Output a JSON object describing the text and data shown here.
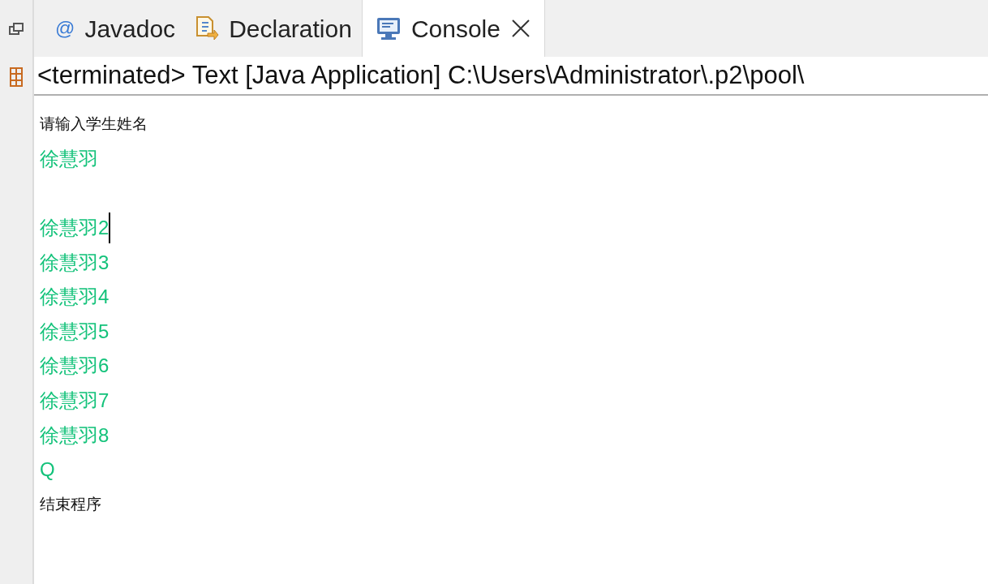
{
  "tabs": [
    {
      "label": "Javadoc",
      "kind": "javadoc",
      "glyph": "@",
      "selected": false
    },
    {
      "label": "Declaration",
      "kind": "declaration",
      "selected": false
    },
    {
      "label": "Console",
      "kind": "console",
      "selected": true
    }
  ],
  "console": {
    "title": "<terminated> Text [Java Application] C:\\Users\\Administrator\\.p2\\pool\\",
    "blocks": [
      [
        {
          "kind": "output",
          "text": "请输入学生姓名",
          "cursor": false
        },
        {
          "kind": "input",
          "text": "徐慧羽",
          "cursor": false
        }
      ],
      [
        {
          "kind": "input",
          "text": "徐慧羽2",
          "cursor": true
        },
        {
          "kind": "input",
          "text": "徐慧羽3",
          "cursor": false
        },
        {
          "kind": "input",
          "text": "徐慧羽4",
          "cursor": false
        },
        {
          "kind": "input",
          "text": "徐慧羽5",
          "cursor": false
        },
        {
          "kind": "input",
          "text": "徐慧羽6",
          "cursor": false
        },
        {
          "kind": "input",
          "text": "徐慧羽7",
          "cursor": false
        },
        {
          "kind": "input",
          "text": "徐慧羽8",
          "cursor": false
        },
        {
          "kind": "input",
          "text": "Q",
          "cursor": false
        },
        {
          "kind": "output",
          "text": "结束程序",
          "cursor": false
        }
      ]
    ]
  }
}
